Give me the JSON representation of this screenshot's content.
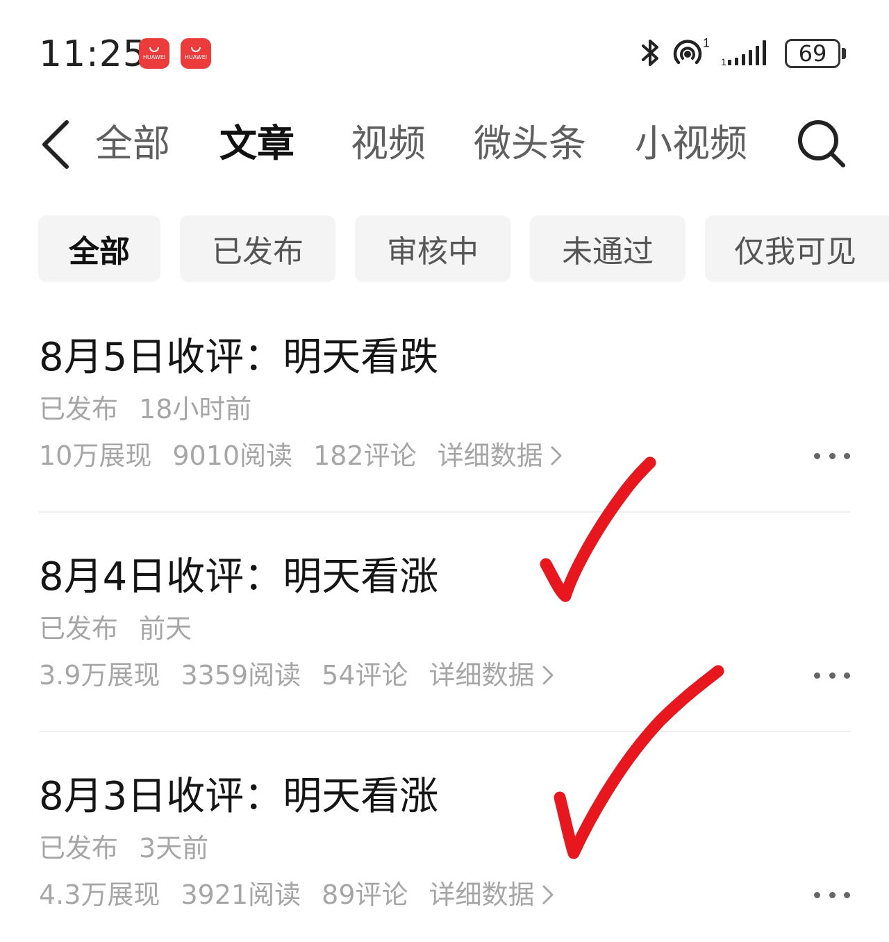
{
  "status_bar": {
    "time": "11:25",
    "app_badges": [
      "HUAWEI",
      "HUAWEI"
    ],
    "hotspot_superscript": "1",
    "battery": "69",
    "icons": [
      "bluetooth-icon",
      "hotspot-icon",
      "signal-icon",
      "battery-icon"
    ]
  },
  "header": {
    "tabs": [
      {
        "label": "全部",
        "active": false
      },
      {
        "label": "文章",
        "active": true
      },
      {
        "label": "视频",
        "active": false
      },
      {
        "label": "微头条",
        "active": false
      },
      {
        "label": "小视频",
        "active": false
      }
    ],
    "icons": [
      "back-icon",
      "search-icon"
    ]
  },
  "filters": [
    {
      "label": "全部",
      "active": true
    },
    {
      "label": "已发布",
      "active": false
    },
    {
      "label": "审核中",
      "active": false
    },
    {
      "label": "未通过",
      "active": false
    },
    {
      "label": "仅我可见",
      "active": false
    }
  ],
  "articles": [
    {
      "title": "8月5日收评：明天看跌",
      "status": "已发布",
      "time": "18小时前",
      "impressions": "10万展现",
      "reads": "9010阅读",
      "comments": "182评论",
      "detail_label": "详细数据"
    },
    {
      "title": "8月4日收评：明天看涨",
      "status": "已发布",
      "time": "前天",
      "impressions": "3.9万展现",
      "reads": "3359阅读",
      "comments": "54评论",
      "detail_label": "详细数据"
    },
    {
      "title": "8月3日收评：明天看涨",
      "status": "已发布",
      "time": "3天前",
      "impressions": "4.3万展现",
      "reads": "3921阅读",
      "comments": "89评论",
      "detail_label": "详细数据"
    }
  ],
  "annotation_color": "#e8171e"
}
